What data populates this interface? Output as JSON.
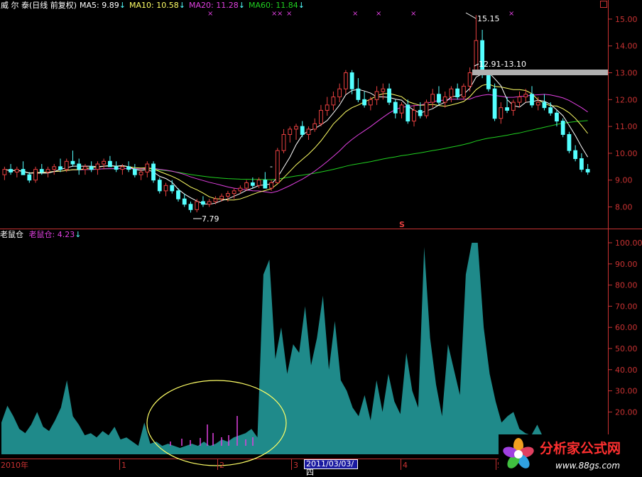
{
  "header": {
    "stock": "威 尔 泰(日线 前复权)",
    "ma5": "MA5: 9.89",
    "ma10": "MA10: 10.58",
    "ma20": "MA20: 11.28",
    "ma60": "MA60: 11.84"
  },
  "indicator_header": {
    "name": "老鼠仓",
    "value_label": "老鼠仓: 4.23"
  },
  "annotations": {
    "high": "15.15",
    "range": "12.91-13.10",
    "low": "7.79",
    "s_marker": "S"
  },
  "time_axis": {
    "year": "2010年",
    "m1": "1",
    "m2": "2",
    "m3": "3",
    "m4": "4",
    "m5": "5",
    "date_box": "2011/03/03/四"
  },
  "logo": {
    "name": "分析家公式网",
    "url": "www.88gs.com"
  },
  "colors": {
    "axis": "#c83232",
    "up": "#e84040",
    "down": "#54ffff",
    "ma5": "#ffffff",
    "ma10": "#ffff66",
    "ma20": "#e040e0",
    "ma60": "#20d020",
    "area": "#1f8a8a",
    "ellipse": "#ffff66"
  },
  "chart_data": [
    {
      "type": "candlestick",
      "title": "威 尔 泰(日线 前复权)",
      "ylim": [
        7.3,
        15.5
      ],
      "y_ticks": [
        "15.00",
        "14.00",
        "13.00",
        "12.00",
        "11.00",
        "10.00",
        "9.00",
        "8.00"
      ],
      "x_labels": [
        "2010年",
        "1",
        "2",
        "3",
        "4",
        "5"
      ],
      "candles": [
        [
          9.2,
          9.5,
          9.0,
          9.4
        ],
        [
          9.4,
          9.6,
          9.2,
          9.3
        ],
        [
          9.3,
          9.5,
          9.1,
          9.4
        ],
        [
          9.4,
          9.7,
          9.2,
          9.2
        ],
        [
          9.2,
          9.3,
          8.9,
          9.0
        ],
        [
          9.0,
          9.5,
          8.9,
          9.4
        ],
        [
          9.4,
          9.6,
          9.2,
          9.3
        ],
        [
          9.3,
          9.5,
          9.1,
          9.4
        ],
        [
          9.4,
          9.6,
          9.2,
          9.5
        ],
        [
          9.5,
          9.8,
          9.3,
          9.4
        ],
        [
          9.4,
          9.8,
          9.3,
          9.7
        ],
        [
          9.7,
          10.1,
          9.5,
          9.6
        ],
        [
          9.6,
          9.8,
          9.2,
          9.4
        ],
        [
          9.4,
          9.6,
          9.2,
          9.5
        ],
        [
          9.5,
          9.7,
          9.3,
          9.4
        ],
        [
          9.4,
          9.7,
          9.2,
          9.6
        ],
        [
          9.6,
          9.8,
          9.4,
          9.7
        ],
        [
          9.7,
          9.9,
          9.5,
          9.5
        ],
        [
          9.5,
          9.7,
          9.3,
          9.4
        ],
        [
          9.4,
          9.6,
          9.2,
          9.5
        ],
        [
          9.5,
          9.7,
          9.3,
          9.4
        ],
        [
          9.4,
          9.6,
          9.1,
          9.2
        ],
        [
          9.2,
          9.4,
          9.0,
          9.3
        ],
        [
          9.3,
          9.7,
          9.1,
          9.6
        ],
        [
          9.6,
          9.7,
          8.9,
          9.0
        ],
        [
          9.0,
          9.1,
          8.5,
          8.6
        ],
        [
          8.6,
          8.9,
          8.4,
          8.8
        ],
        [
          8.8,
          9.0,
          8.5,
          8.6
        ],
        [
          8.6,
          8.7,
          8.2,
          8.3
        ],
        [
          8.3,
          8.5,
          8.0,
          8.1
        ],
        [
          8.1,
          8.2,
          7.79,
          7.9
        ],
        [
          7.9,
          8.3,
          7.8,
          8.2
        ],
        [
          8.2,
          8.4,
          8.0,
          8.1
        ],
        [
          8.1,
          8.3,
          8.0,
          8.2
        ],
        [
          8.2,
          8.4,
          8.1,
          8.3
        ],
        [
          8.3,
          8.5,
          8.2,
          8.4
        ],
        [
          8.4,
          8.6,
          8.2,
          8.5
        ],
        [
          8.5,
          8.7,
          8.3,
          8.6
        ],
        [
          8.6,
          8.8,
          8.5,
          8.7
        ],
        [
          8.7,
          9.0,
          8.6,
          8.9
        ],
        [
          8.9,
          9.1,
          8.7,
          8.8
        ],
        [
          8.8,
          9.1,
          8.7,
          9.0
        ],
        [
          9.0,
          9.3,
          8.8,
          8.7
        ],
        [
          8.7,
          9.0,
          8.6,
          8.9
        ],
        [
          8.9,
          10.2,
          8.9,
          10.1
        ],
        [
          10.1,
          10.9,
          10.0,
          10.7
        ],
        [
          10.7,
          11.0,
          10.4,
          10.9
        ],
        [
          10.9,
          11.1,
          10.5,
          11.0
        ],
        [
          11.0,
          11.2,
          10.6,
          10.7
        ],
        [
          10.7,
          11.0,
          10.5,
          10.9
        ],
        [
          10.9,
          11.3,
          10.8,
          11.1
        ],
        [
          11.1,
          11.8,
          11.0,
          11.6
        ],
        [
          11.6,
          12.1,
          11.4,
          11.8
        ],
        [
          11.8,
          12.3,
          11.6,
          12.1
        ],
        [
          12.1,
          12.6,
          11.9,
          12.4
        ],
        [
          12.4,
          13.1,
          12.2,
          13.0
        ],
        [
          13.0,
          13.1,
          12.2,
          12.4
        ],
        [
          12.4,
          12.8,
          11.9,
          12.0
        ],
        [
          12.0,
          12.3,
          11.7,
          11.8
        ],
        [
          11.8,
          12.1,
          11.6,
          12.0
        ],
        [
          12.0,
          12.5,
          11.8,
          12.3
        ],
        [
          12.3,
          12.6,
          12.0,
          12.4
        ],
        [
          12.4,
          12.6,
          11.8,
          11.9
        ],
        [
          11.9,
          12.0,
          11.3,
          11.5
        ],
        [
          11.5,
          11.9,
          11.3,
          11.8
        ],
        [
          11.8,
          12.0,
          11.1,
          11.2
        ],
        [
          11.2,
          11.8,
          11.0,
          11.6
        ],
        [
          11.6,
          11.9,
          11.3,
          11.4
        ],
        [
          11.4,
          12.0,
          11.3,
          11.9
        ],
        [
          11.9,
          12.4,
          11.7,
          12.2
        ],
        [
          12.2,
          12.5,
          11.8,
          11.9
        ],
        [
          11.9,
          12.3,
          11.7,
          12.1
        ],
        [
          12.1,
          12.5,
          11.9,
          12.4
        ],
        [
          12.4,
          12.6,
          12.0,
          12.1
        ],
        [
          12.1,
          12.6,
          12.0,
          12.5
        ],
        [
          12.5,
          13.2,
          12.3,
          13.0
        ],
        [
          13.0,
          15.15,
          12.9,
          14.2
        ],
        [
          14.2,
          14.6,
          12.8,
          13.0
        ],
        [
          13.0,
          13.1,
          12.3,
          12.4
        ],
        [
          12.4,
          12.6,
          11.2,
          11.3
        ],
        [
          11.3,
          11.9,
          11.1,
          11.7
        ],
        [
          11.7,
          12.1,
          11.5,
          11.6
        ],
        [
          11.6,
          12.0,
          11.4,
          11.9
        ],
        [
          11.9,
          12.3,
          11.7,
          12.1
        ],
        [
          12.1,
          12.4,
          11.9,
          12.2
        ],
        [
          12.2,
          12.5,
          11.7,
          11.8
        ],
        [
          11.8,
          12.1,
          11.6,
          11.9
        ],
        [
          11.9,
          12.2,
          11.6,
          11.7
        ],
        [
          11.7,
          11.9,
          11.4,
          11.5
        ],
        [
          11.5,
          11.6,
          11.0,
          11.2
        ],
        [
          11.2,
          11.3,
          10.6,
          10.7
        ],
        [
          10.7,
          10.8,
          10.0,
          10.1
        ],
        [
          10.1,
          10.3,
          9.7,
          9.8
        ],
        [
          9.8,
          10.0,
          9.3,
          9.4
        ],
        [
          9.4,
          9.6,
          9.2,
          9.3
        ]
      ],
      "ma_labels": [
        "MA5: 9.89",
        "MA10: 10.58",
        "MA20: 11.28",
        "MA60: 11.84"
      ],
      "annotations": [
        "15.15",
        "12.91-13.10",
        "7.79"
      ]
    },
    {
      "type": "area",
      "title": "老鼠仓",
      "ylim": [
        0,
        100
      ],
      "y_ticks": [
        "100.00",
        "90.00",
        "80.00",
        "70.00",
        "60.00",
        "50.00",
        "40.00",
        "30.00",
        "20.00"
      ],
      "values": [
        15,
        23,
        18,
        12,
        10,
        14,
        20,
        13,
        11,
        16,
        22,
        35,
        18,
        14,
        9,
        10,
        8,
        11,
        9,
        13,
        7,
        8,
        6,
        4,
        15,
        5,
        6,
        4,
        5,
        4,
        3,
        4,
        5,
        4,
        6,
        4,
        5,
        7,
        6,
        8,
        9,
        10,
        12,
        8,
        85,
        92,
        45,
        60,
        38,
        52,
        48,
        70,
        42,
        55,
        75,
        40,
        63,
        35,
        30,
        22,
        18,
        28,
        16,
        35,
        20,
        38,
        25,
        19,
        48,
        30,
        22,
        98,
        55,
        33,
        18,
        52,
        40,
        28,
        85,
        100,
        100,
        60,
        38,
        25,
        15,
        18,
        20,
        12,
        10,
        9,
        14,
        8,
        6,
        7,
        9,
        5,
        6,
        4,
        4,
        4
      ],
      "series_label": "老鼠仓: 4.23"
    }
  ]
}
